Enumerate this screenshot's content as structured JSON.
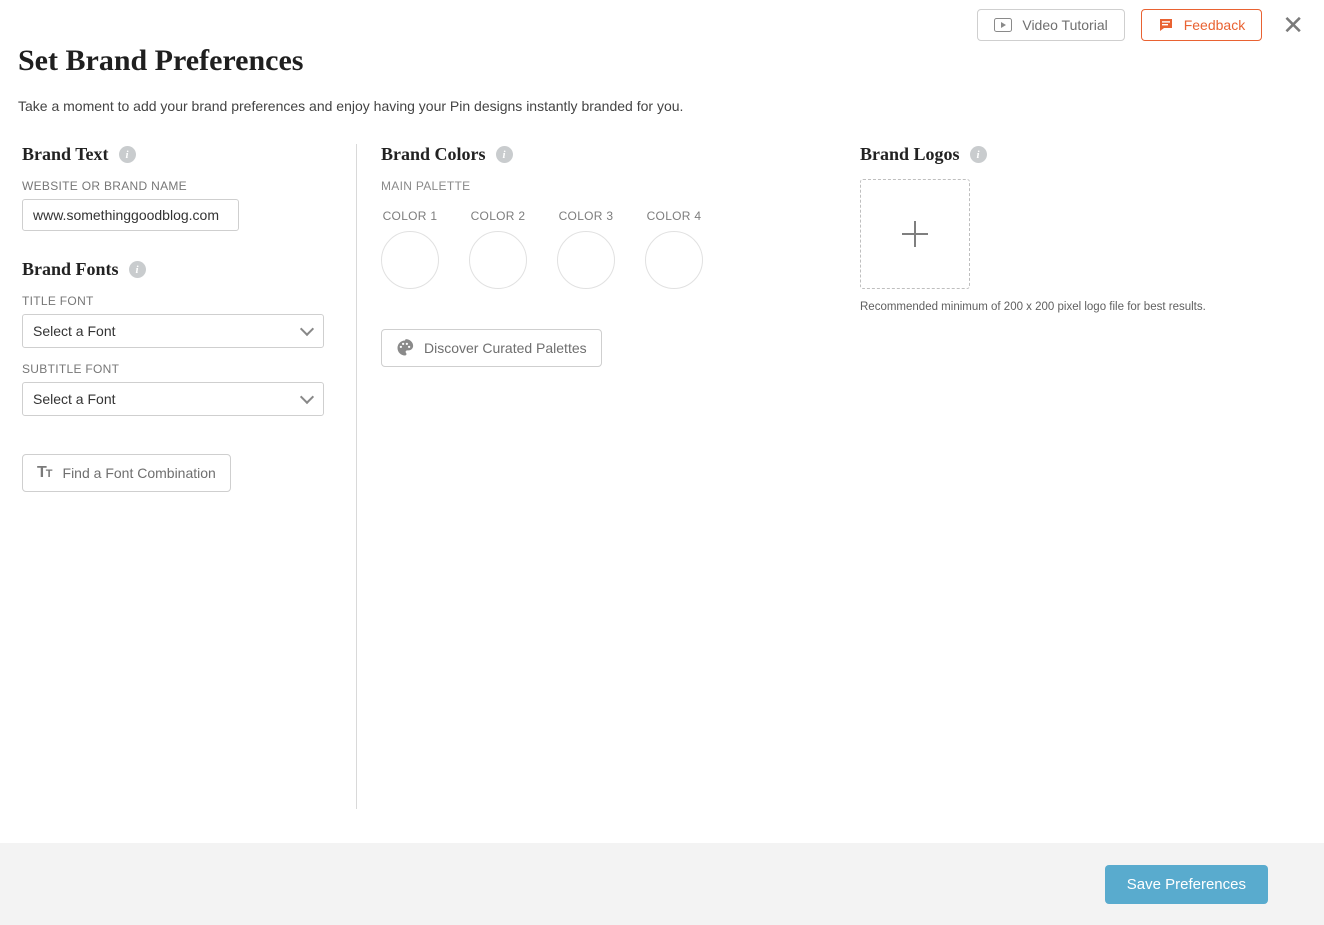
{
  "top": {
    "video_tutorial": "Video Tutorial",
    "feedback": "Feedback"
  },
  "header": {
    "title": "Set Brand Preferences",
    "subtitle": "Take a moment to add your brand preferences and enjoy having your Pin designs instantly branded for you."
  },
  "brand_text": {
    "heading": "Brand Text",
    "website_label": "WEBSITE OR BRAND NAME",
    "website_value": "www.somethinggoodblog.com"
  },
  "brand_fonts": {
    "heading": "Brand Fonts",
    "title_label": "TITLE FONT",
    "subtitle_label": "SUBTITLE FONT",
    "select_placeholder": "Select a Font",
    "find_combo": "Find a Font Combination"
  },
  "brand_colors": {
    "heading": "Brand Colors",
    "main_palette": "MAIN PALETTE",
    "swatches": [
      {
        "label": "COLOR 1"
      },
      {
        "label": "COLOR 2"
      },
      {
        "label": "COLOR 3"
      },
      {
        "label": "COLOR 4"
      }
    ],
    "discover": "Discover Curated Palettes"
  },
  "brand_logos": {
    "heading": "Brand Logos",
    "hint": "Recommended minimum of 200 x 200 pixel logo file for best results."
  },
  "footer": {
    "save": "Save Preferences"
  }
}
